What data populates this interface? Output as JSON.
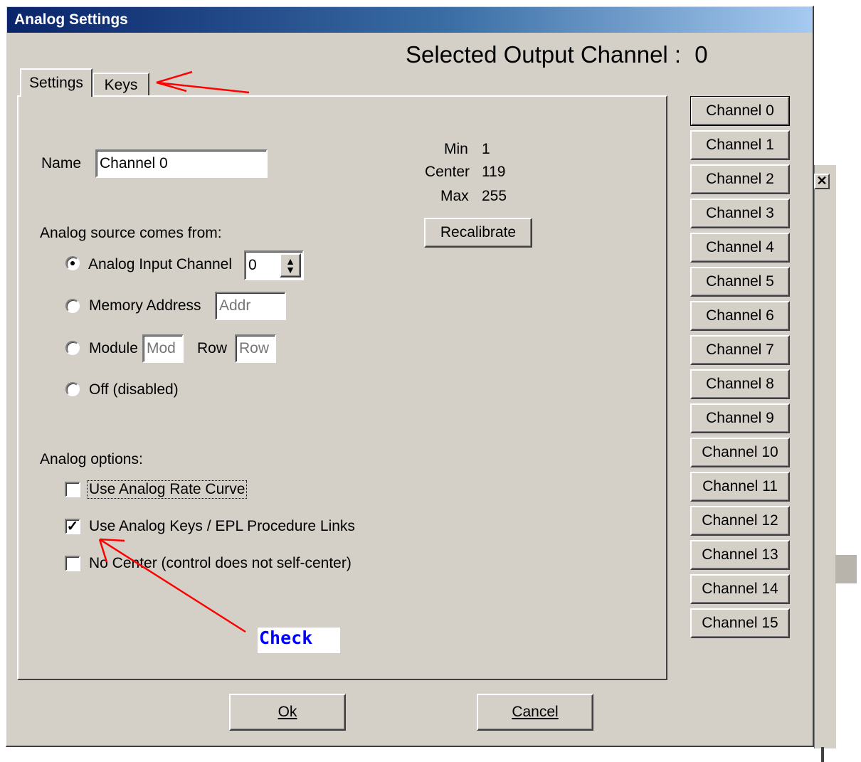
{
  "window": {
    "title": "Analog Settings"
  },
  "header": {
    "selected_label": "Selected Output Channel :",
    "selected_value": "0"
  },
  "tabs": [
    {
      "label": "Settings",
      "active": true
    },
    {
      "label": "Keys",
      "active": false
    }
  ],
  "settings": {
    "name_label": "Name",
    "name_value": "Channel 0",
    "source_heading": "Analog source comes from:",
    "source_analog_label": "Analog Input Channel",
    "source_analog_value": "0",
    "source_memory_label": "Memory Address",
    "source_memory_placeholder": "Addr",
    "source_module_label": "Module",
    "source_module_placeholder": "Mod",
    "source_row_label": "Row",
    "source_row_placeholder": "Row",
    "source_off_label": "Off (disabled)",
    "selected_source": "analog",
    "options_heading": "Analog options:",
    "opt_rate_curve": {
      "label": "Use Analog Rate Curve",
      "checked": false
    },
    "opt_keys": {
      "label": "Use Analog Keys / EPL Procedure Links",
      "checked": true
    },
    "opt_no_center": {
      "label": "No Center (control does not self-center)",
      "checked": false
    }
  },
  "calibration": {
    "min_label": "Min",
    "min_value": "1",
    "center_label": "Center",
    "center_value": "119",
    "max_label": "Max",
    "max_value": "255",
    "recalibrate_label": "Recalibrate"
  },
  "channels": [
    "Channel 0",
    "Channel 1",
    "Channel 2",
    "Channel 3",
    "Channel 4",
    "Channel 5",
    "Channel 6",
    "Channel 7",
    "Channel 8",
    "Channel 9",
    "Channel 10",
    "Channel 11",
    "Channel 12",
    "Channel 13",
    "Channel 14",
    "Channel 15"
  ],
  "footer": {
    "ok_label": "Ok",
    "cancel_label": "Cancel"
  },
  "annotation": {
    "text": "Check",
    "arrow_color": "#ff0000",
    "text_color": "#0000ff"
  },
  "colors": {
    "dialog_bg": "#d4d0c8",
    "title_start": "#0a246a",
    "title_end": "#a6caf0"
  }
}
